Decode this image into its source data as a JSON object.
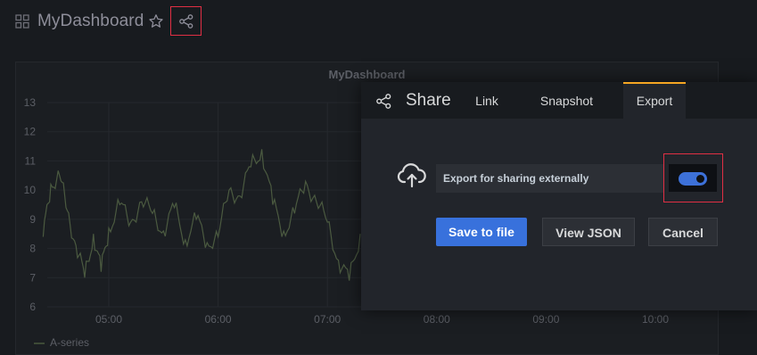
{
  "dashboard": {
    "title": "MyDashboard",
    "icons": {
      "grid": "grid-icon",
      "star": "star-icon",
      "share": "share-icon"
    }
  },
  "panel": {
    "title": "MyDashboard",
    "legend": "A-series"
  },
  "chart_data": {
    "type": "line",
    "title": "MyDashboard",
    "yticks": [
      13,
      12,
      11,
      10,
      9,
      8,
      7,
      6
    ],
    "xticks": [
      "05:00",
      "06:00",
      "07:00",
      "08:00",
      "09:00",
      "10:00"
    ],
    "ylim": [
      6,
      13
    ],
    "grid": true,
    "legend_position": "bottom-left",
    "series": [
      {
        "name": "A-series",
        "color": "#4b5a40",
        "x_hours": [
          4.4,
          4.47,
          4.55,
          4.62,
          4.7,
          4.78,
          4.86,
          4.93,
          5.0,
          5.1,
          5.2,
          5.3,
          5.4,
          5.5,
          5.6,
          5.7,
          5.8,
          5.9,
          6.0,
          6.1,
          6.2,
          6.3,
          6.4,
          6.5,
          6.6,
          6.7,
          6.8,
          6.9,
          7.0,
          7.1,
          7.2,
          7.3
        ],
        "values": [
          8.4,
          10.2,
          10.5,
          9.3,
          8.1,
          7.0,
          8.5,
          7.2,
          8.7,
          9.5,
          8.9,
          9.6,
          9.2,
          8.6,
          9.4,
          8.3,
          9.0,
          8.2,
          8.4,
          10.0,
          9.8,
          10.8,
          11.4,
          9.5,
          8.6,
          9.2,
          10.3,
          9.6,
          8.9,
          7.6,
          6.9,
          8.5
        ]
      }
    ]
  },
  "share_modal": {
    "title": "Share",
    "tabs": [
      {
        "label": "Link",
        "active": false
      },
      {
        "label": "Snapshot",
        "active": false
      },
      {
        "label": "Export",
        "active": true
      }
    ],
    "export_label": "Export for sharing externally",
    "export_toggle_on": true,
    "buttons": {
      "save": "Save to file",
      "view_json": "View JSON",
      "cancel": "Cancel"
    }
  },
  "colors": {
    "accent": "#3871dc",
    "highlight": "#e02f44",
    "tab_active": "#f5a623",
    "toggle_on": "#3d71d9"
  }
}
